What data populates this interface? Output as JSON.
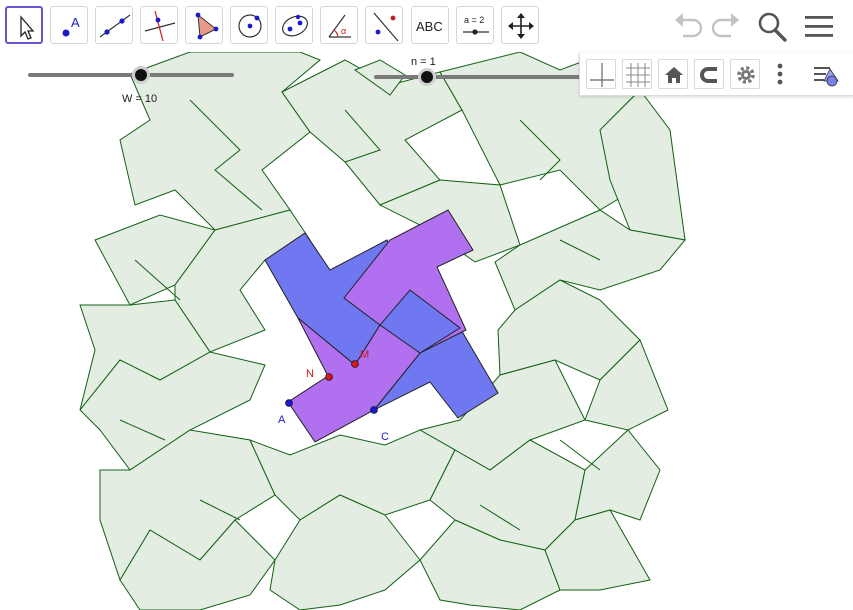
{
  "toolbar": {
    "tools": [
      {
        "name": "move-tool-button",
        "icon": "move-arrow-icon",
        "active": true
      },
      {
        "name": "point-tool-button",
        "icon": "point-icon",
        "label": "A"
      },
      {
        "name": "line-tool-button",
        "icon": "line-icon"
      },
      {
        "name": "perpendicular-tool-button",
        "icon": "perpendicular-line-icon"
      },
      {
        "name": "polygon-tool-button",
        "icon": "polygon-icon"
      },
      {
        "name": "circle-tool-button",
        "icon": "circle-icon"
      },
      {
        "name": "ellipse-tool-button",
        "icon": "ellipse-icon"
      },
      {
        "name": "angle-tool-button",
        "icon": "angle-icon",
        "label": "α"
      },
      {
        "name": "reflect-tool-button",
        "icon": "reflect-icon"
      },
      {
        "name": "text-tool-button",
        "icon": "text-icon",
        "label": "ABC"
      },
      {
        "name": "slider-tool-button",
        "icon": "slider-icon",
        "label": "a = 2"
      },
      {
        "name": "move-graphics-view-button",
        "icon": "move-view-icon"
      }
    ],
    "undo_icon": "undo-icon",
    "redo_icon": "redo-icon",
    "search_icon": "search-icon",
    "menu_icon": "hamburger-menu-icon"
  },
  "style_bar": {
    "buttons": [
      "axes-icon",
      "grid-icon",
      "home-icon",
      "magnet-icon",
      "gear-icon",
      "more-vertical-icon",
      "style-bar-toggle-icon"
    ]
  },
  "sliders": [
    {
      "name": "w-slider",
      "label": "W = 10"
    },
    {
      "name": "n-slider",
      "label": "n = 1"
    }
  ],
  "points": [
    {
      "name": "point-a",
      "label": "A",
      "color": "#1a1acc"
    },
    {
      "name": "point-c",
      "label": "C",
      "color": "#1a1acc"
    },
    {
      "name": "point-n",
      "label": "N",
      "color": "#cc1a1a"
    },
    {
      "name": "point-m",
      "label": "M",
      "color": "#cc1a1a"
    }
  ],
  "colors": {
    "tile_fill": "#e3ede2",
    "tile_stroke": "#146014",
    "blue_tile": "#6f78f0",
    "purple_tile": "#b070f0",
    "toolbar_active": "#6557d2"
  }
}
